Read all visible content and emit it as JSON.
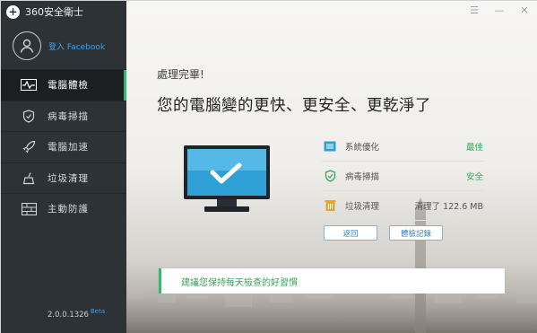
{
  "app": {
    "title": "360安全衛士",
    "version": "2.0.0.1326",
    "version_tag": "Beta"
  },
  "user": {
    "login_label": "登入 Facebook"
  },
  "nav": {
    "items": [
      {
        "label": "電腦體檢",
        "icon": "pulse-icon",
        "active": true
      },
      {
        "label": "病毒掃描",
        "icon": "shield-icon",
        "active": false
      },
      {
        "label": "電腦加速",
        "icon": "rocket-icon",
        "active": false
      },
      {
        "label": "垃圾清理",
        "icon": "broom-icon",
        "active": false
      },
      {
        "label": "主動防護",
        "icon": "firewall-icon",
        "active": false
      }
    ]
  },
  "main": {
    "done_label": "處理完畢!",
    "headline": "您的電腦變的更快、更安全、更乾淨了",
    "results": [
      {
        "label": "系統優化",
        "value": "最佳",
        "icon": "system-optimize-icon"
      },
      {
        "label": "病毒掃描",
        "value": "安全",
        "icon": "virus-shield-icon"
      },
      {
        "label": "垃圾清理",
        "value": "清理了 122.6 MB",
        "icon": "trash-icon"
      }
    ],
    "buttons": {
      "back": "返回",
      "history": "體檢記錄"
    },
    "tip": "建議您保持每天檢查的好習慣"
  },
  "colors": {
    "accent": "#33b970",
    "sidebar": "#2d3237",
    "link": "#3ea0e6"
  }
}
